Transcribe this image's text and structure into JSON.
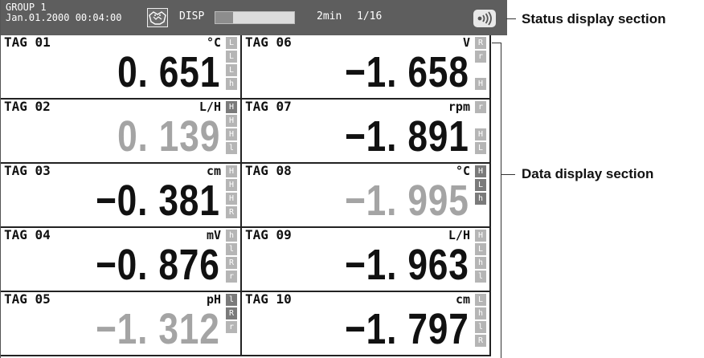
{
  "status": {
    "group": "GROUP 1",
    "datetime": "Jan.01.2000 00:04:00",
    "display_mode": "DISP",
    "progress": 0.22,
    "interval": "2min",
    "page": "1/16"
  },
  "channels": [
    {
      "tag": "TAG 01",
      "unit": "°C",
      "value": "0. 651",
      "dim": false,
      "alarms": [
        "L",
        "L",
        "L",
        "h"
      ],
      "active": [
        false,
        false,
        false,
        false
      ]
    },
    {
      "tag": "TAG 06",
      "unit": "V",
      "value": "−1. 658",
      "dim": false,
      "alarms": [
        "R",
        "r",
        "",
        "H"
      ],
      "active": [
        false,
        false,
        false,
        false
      ]
    },
    {
      "tag": "TAG 02",
      "unit": "L/H",
      "value": "0. 139",
      "dim": true,
      "alarms": [
        "H",
        "H",
        "H",
        "l"
      ],
      "active": [
        true,
        false,
        false,
        false
      ]
    },
    {
      "tag": "TAG 07",
      "unit": "rpm",
      "value": "−1. 891",
      "dim": false,
      "alarms": [
        "r",
        "",
        "H",
        "L"
      ],
      "active": [
        false,
        false,
        false,
        false
      ]
    },
    {
      "tag": "TAG 03",
      "unit": "cm",
      "value": "−0. 381",
      "dim": false,
      "alarms": [
        "H",
        "H",
        "H",
        "R"
      ],
      "active": [
        false,
        false,
        false,
        false
      ]
    },
    {
      "tag": "TAG 08",
      "unit": "°C",
      "value": "−1. 995",
      "dim": true,
      "alarms": [
        "H",
        "L",
        "h",
        ""
      ],
      "active": [
        true,
        true,
        true,
        false
      ]
    },
    {
      "tag": "TAG 04",
      "unit": "mV",
      "value": "−0. 876",
      "dim": false,
      "alarms": [
        "h",
        "l",
        "R",
        "r"
      ],
      "active": [
        false,
        false,
        false,
        false
      ]
    },
    {
      "tag": "TAG 09",
      "unit": "L/H",
      "value": "−1. 963",
      "dim": false,
      "alarms": [
        "H",
        "L",
        "h",
        "l"
      ],
      "active": [
        false,
        false,
        false,
        false
      ]
    },
    {
      "tag": "TAG 05",
      "unit": "pH",
      "value": "−1. 312",
      "dim": true,
      "alarms": [
        "l",
        "R",
        "r",
        ""
      ],
      "active": [
        true,
        true,
        false,
        false
      ]
    },
    {
      "tag": "TAG 10",
      "unit": "cm",
      "value": "−1. 797",
      "dim": false,
      "alarms": [
        "L",
        "h",
        "l",
        "R"
      ],
      "active": [
        false,
        false,
        false,
        false
      ]
    }
  ],
  "callouts": {
    "status": "Status display section",
    "data": "Data display section"
  },
  "colors": {
    "status_bar": "#5e5e5e",
    "alarm_active": "#7a7a7a",
    "alarm_idle": "#b5b5b5",
    "value_dim": "#a4a4a4"
  },
  "icons": {
    "mode": "display-mode-icon",
    "comm": "communication-icon"
  }
}
